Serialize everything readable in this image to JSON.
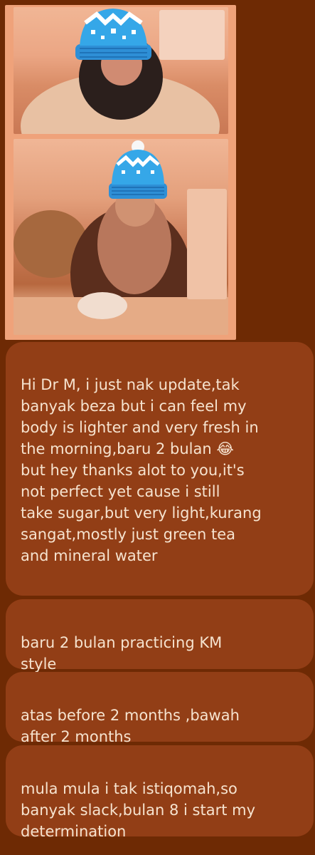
{
  "photo": {
    "top_caption": "",
    "bottom_caption": ""
  },
  "messages": [
    {
      "text": "Hi Dr M, i just nak update,tak\nbanyak beza but i can feel my\nbody is lighter and very fresh in\nthe morning,baru 2 bulan 😂\nbut hey thanks alot to you,it's\nnot perfect yet cause i still\ntake sugar,but very light,kurang\nsangat,mostly just green tea\nand mineral water"
    },
    {
      "text": "baru 2 bulan practicing KM\nstyle"
    },
    {
      "text": "atas before 2 months ,bawah\nafter 2 months"
    },
    {
      "text": "mula mula i tak istiqomah,so\nbanyak slack,bulan 8 i start my\ndetermination"
    }
  ],
  "colors": {
    "background": "#6e2a04",
    "bubble": "#923e16",
    "text": "#f6e3cf",
    "photo_frame": "#efa27a",
    "beanie": "#2e8fd6"
  },
  "icons": [
    "beanie-sticker-icon"
  ]
}
